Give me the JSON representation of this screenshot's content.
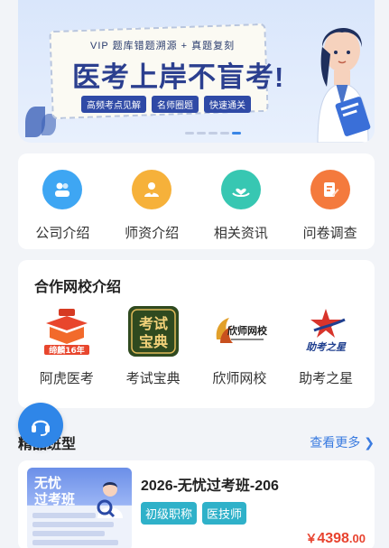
{
  "banner": {
    "sub": "VIP 题库错题溯源 + 真题复刻",
    "headline": "医考上岸不盲考!",
    "tags": [
      "高频考点见解",
      "名师圈题",
      "快速通关"
    ]
  },
  "quick": {
    "items": [
      {
        "label": "公司介绍",
        "icon": "company-icon",
        "color": "#3ea6f3"
      },
      {
        "label": "师资介绍",
        "icon": "teachers-icon",
        "color": "#f6b13a"
      },
      {
        "label": "相关资讯",
        "icon": "news-icon",
        "color": "#37c7b2"
      },
      {
        "label": "问卷调查",
        "icon": "survey-icon",
        "color": "#f47a3d"
      }
    ]
  },
  "partners": {
    "title": "合作网校介绍",
    "items": [
      {
        "label": "阿虎医考",
        "logo_text": "缔麟16年"
      },
      {
        "label": "考试宝典",
        "logo_text_1": "考试",
        "logo_text_2": "宝典"
      },
      {
        "label": "欣师网校",
        "logo_text": "欣师网校"
      },
      {
        "label": "助考之星",
        "logo_text": "助考之星"
      }
    ]
  },
  "featured": {
    "title": "精品班型",
    "more": "查看更多",
    "course": {
      "name": "2026-无忧过考班-206",
      "thumb_line1": "无忧",
      "thumb_line2": "过考班",
      "tags": [
        "初级职称",
        "医技师"
      ],
      "price_symbol": "￥",
      "price_int": "4398",
      "price_dec": ".00"
    }
  },
  "colors": {
    "accent": "#3a7be0",
    "price": "#e8432f",
    "tag": "#2fb1c9"
  }
}
